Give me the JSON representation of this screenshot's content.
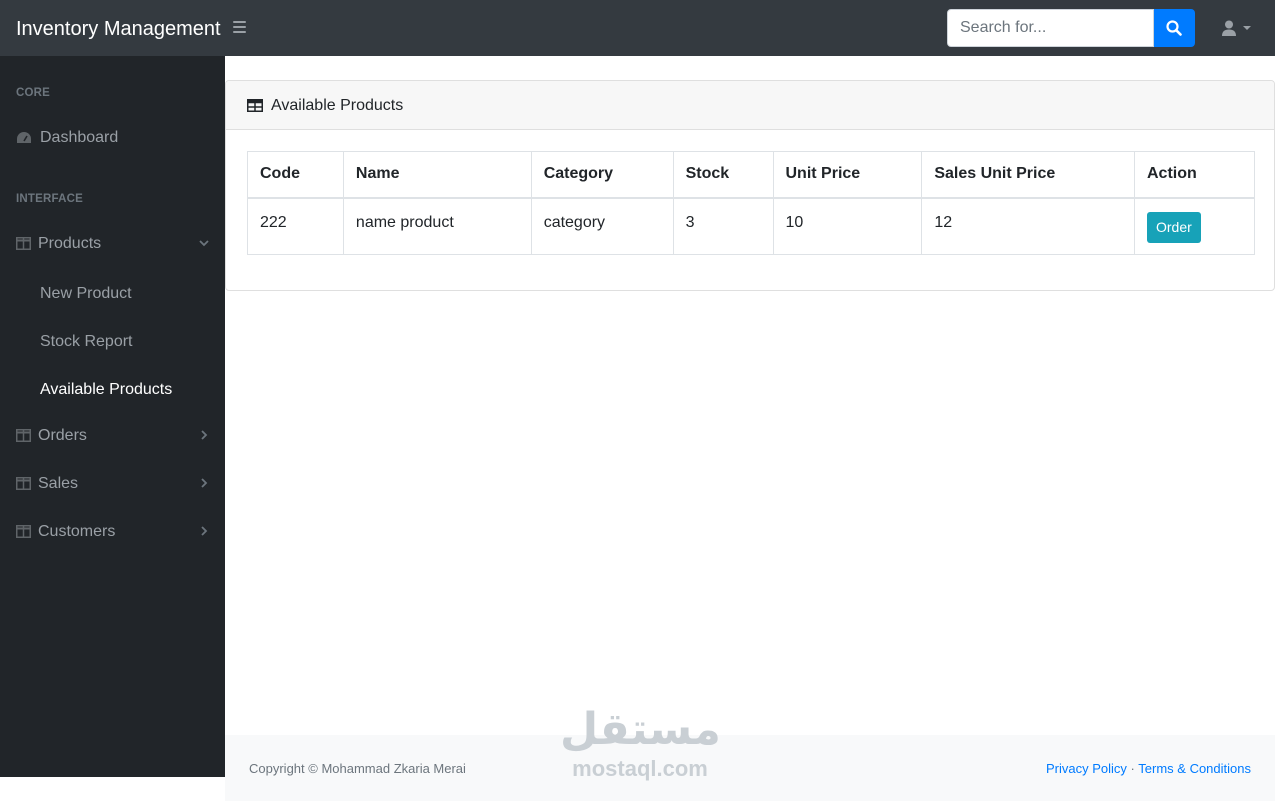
{
  "navbar": {
    "brand": "Inventory Management",
    "search_placeholder": "Search for..."
  },
  "sidebar": {
    "heading_core": "CORE",
    "dashboard": "Dashboard",
    "heading_interface": "INTERFACE",
    "products": "Products",
    "products_children": [
      "New Product",
      "Stock Report",
      "Available Products"
    ],
    "orders": "Orders",
    "sales": "Sales",
    "customers": "Customers"
  },
  "card": {
    "title": "Available Products"
  },
  "table": {
    "headers": [
      "Code",
      "Name",
      "Category",
      "Stock",
      "Unit Price",
      "Sales Unit Price",
      "Action"
    ],
    "rows": [
      {
        "code": "222",
        "name": "name product",
        "category": "category",
        "stock": "3",
        "unit_price": "10",
        "sales_unit_price": "12",
        "action": "Order"
      }
    ]
  },
  "footer": {
    "copyright": "Copyright © Mohammad Zkaria Merai",
    "privacy": "Privacy Policy",
    "separator": "·",
    "terms": "Terms & Conditions"
  },
  "watermark": {
    "arabic": "مستقل",
    "latin": "mostaql.com"
  },
  "colors": {
    "navbar": "#343a40",
    "sidebar": "#212529",
    "primary": "#007bff",
    "info": "#17a2b8"
  }
}
